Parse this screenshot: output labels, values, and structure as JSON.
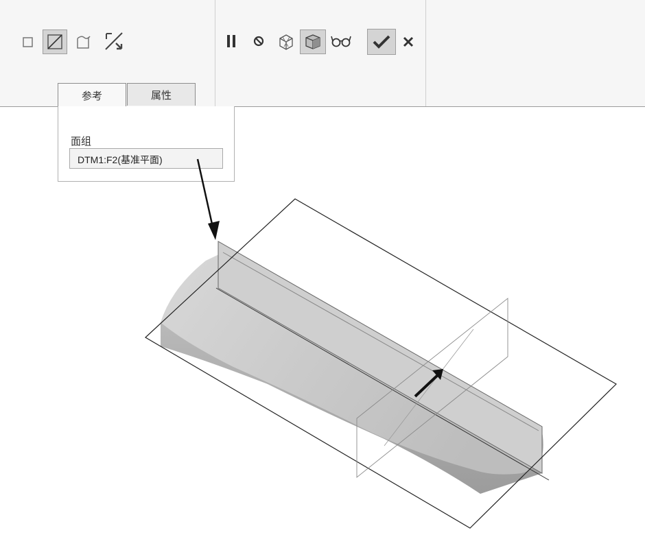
{
  "dashboard": {
    "tools_left": [
      {
        "name": "one-side-icon"
      },
      {
        "name": "thicken-side-icon"
      },
      {
        "name": "quilt-surface-icon"
      },
      {
        "name": "flip-direction-icon"
      }
    ],
    "tools_right": [
      {
        "name": "pause-icon"
      },
      {
        "name": "no-preview-icon"
      },
      {
        "name": "geometry-preview-icon"
      },
      {
        "name": "attached-preview-icon"
      },
      {
        "name": "verify-preview-icon"
      },
      {
        "name": "ok-checkmark-icon"
      },
      {
        "name": "cancel-x-icon"
      }
    ],
    "tabs": [
      {
        "label": "参考"
      },
      {
        "label": "属性"
      }
    ],
    "references_panel": {
      "quilt_label": "面组",
      "quilt_value": "DTM1:F2(基准平面)"
    }
  },
  "colors": {
    "ribbon_bg": "#f6f6f6",
    "active_tool_bg": "#d4d4d4",
    "model_face": "#c6c6c6",
    "model_top": "#d6d6d6",
    "model_side": "#a8a8a8"
  }
}
